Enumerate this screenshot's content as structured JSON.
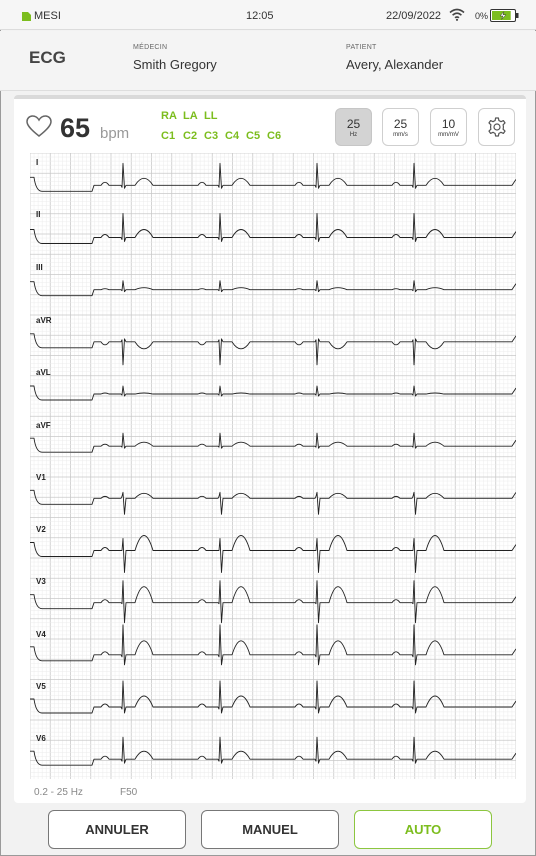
{
  "status_bar": {
    "carrier": "MESI",
    "time": "12:05",
    "date": "22/09/2022",
    "battery_pct": "0%",
    "battery_level": 0.85,
    "accent": "#7cbd1e"
  },
  "header": {
    "title": "ECG",
    "doctor_label": "MÉDECIN",
    "doctor": "Smith Gregory",
    "patient_label": "PATIENT",
    "patient": "Avery, Alexander"
  },
  "vitals": {
    "heart_rate": "65",
    "unit": "bpm",
    "limb_leads": [
      "RA",
      "LA",
      "LL"
    ],
    "chest_leads": [
      "C1",
      "C2",
      "C3",
      "C4",
      "C5",
      "C6"
    ],
    "lead_color": "#7cbd1e"
  },
  "settings": {
    "filter_value": "25",
    "filter_unit": "Hz",
    "speed_value": "25",
    "speed_unit": "mm/s",
    "gain_value": "10",
    "gain_unit": "mm/mV",
    "settings_icon": "gear-icon"
  },
  "ecg": {
    "leads": [
      "I",
      "II",
      "III",
      "aVR",
      "aVL",
      "aVF",
      "V1",
      "V2",
      "V3",
      "V4",
      "V5",
      "V6"
    ],
    "filter_range": "0.2 - 25 Hz",
    "notch": "F50",
    "heart_rate_bpm": 65
  },
  "buttons": {
    "cancel": "ANNULER",
    "manual": "MANUEL",
    "auto": "AUTO"
  }
}
